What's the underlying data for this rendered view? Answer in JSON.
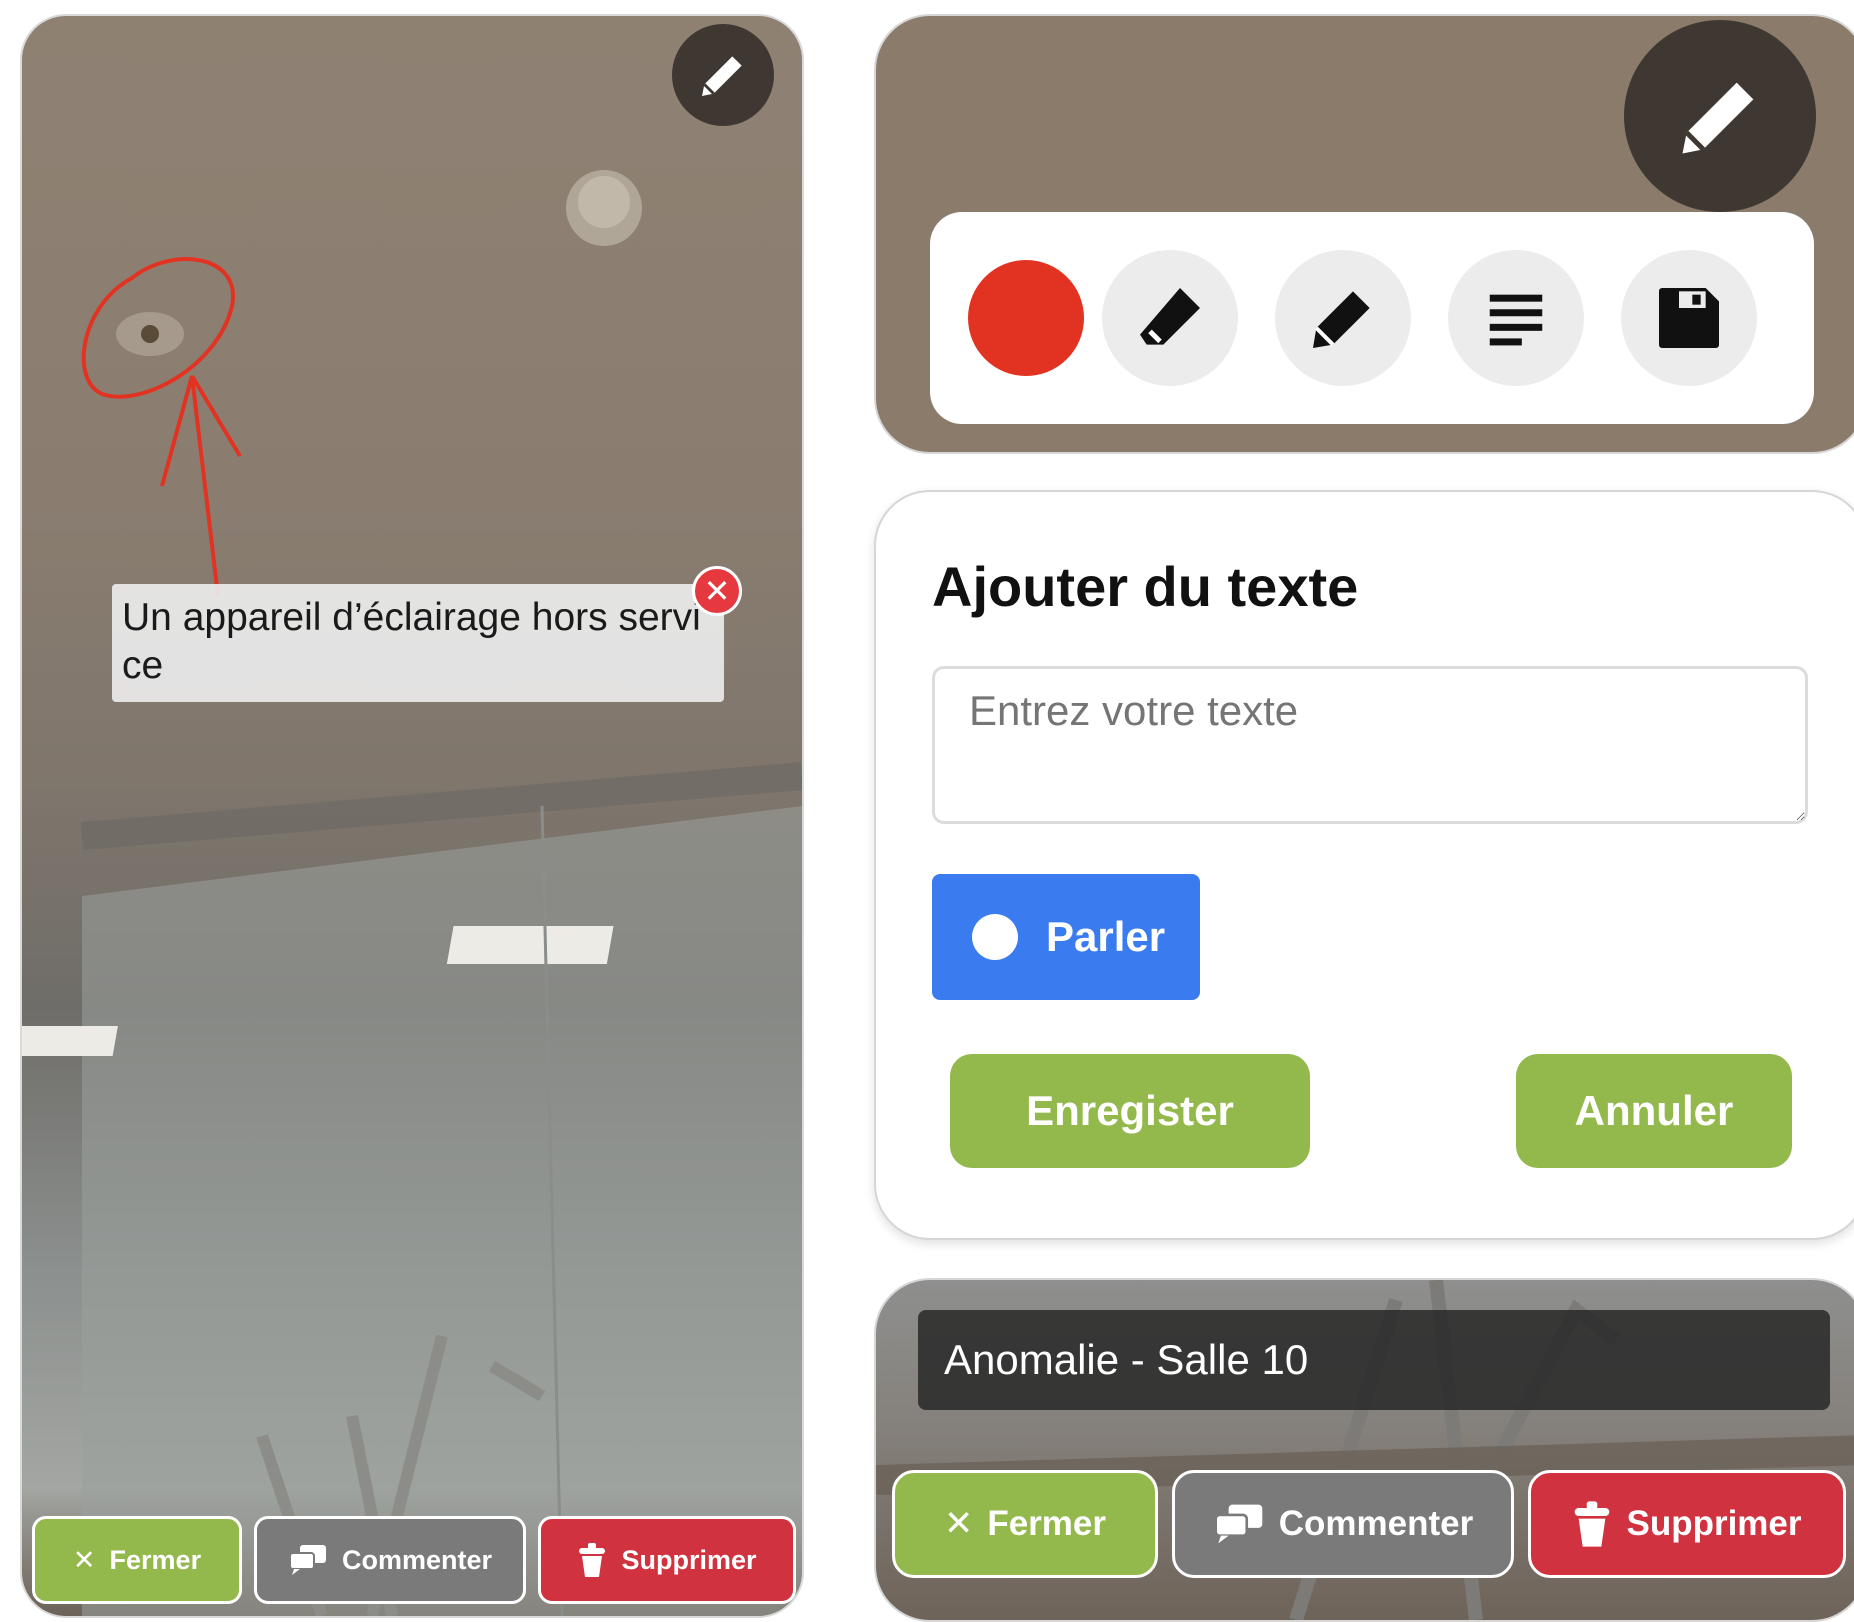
{
  "left_panel": {
    "annotation_text": "Un appareil d’éclairage hors servi ce",
    "buttons": {
      "close": "Fermer",
      "comment": "Commenter",
      "delete": "Supprimer"
    }
  },
  "text_dialog": {
    "title": "Ajouter du texte",
    "input_placeholder": "Entrez votre texte",
    "speak_label": "Parler",
    "save_label": "Enregister",
    "cancel_label": "Annuler"
  },
  "detail_panel": {
    "title": "Anomalie - Salle 10",
    "buttons": {
      "close": "Fermer",
      "comment": "Commenter",
      "delete": "Supprimer"
    }
  },
  "toolbar": {
    "selected_color": "#e23322",
    "tools": [
      "color-picker",
      "eraser-icon",
      "pencil-icon",
      "text-lines-icon",
      "save-icon"
    ]
  },
  "colors": {
    "green": "#93b94d",
    "grey": "#7a7a7a",
    "red": "#d0323f",
    "blue": "#3a7cf0",
    "annotation_red": "#e23322"
  }
}
